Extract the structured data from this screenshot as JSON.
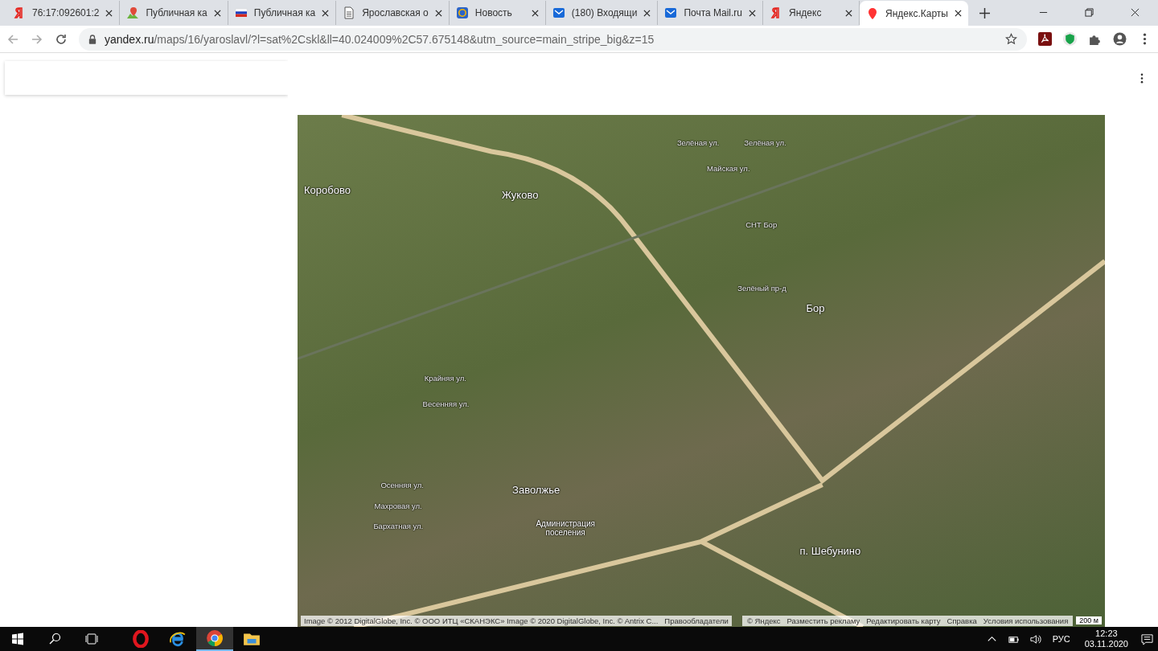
{
  "tabs": [
    {
      "title": "76:17:092601:2",
      "selected": false
    },
    {
      "title": "Публичная ка",
      "selected": false
    },
    {
      "title": "Публичная ка",
      "selected": false
    },
    {
      "title": "Ярославская о",
      "selected": false
    },
    {
      "title": "Новость",
      "selected": false
    },
    {
      "title": "(180) Входящи",
      "selected": false
    },
    {
      "title": "Почта Mail.ru",
      "selected": false
    },
    {
      "title": "Яндекс",
      "selected": false
    },
    {
      "title": "Яндекс.Карты",
      "selected": true
    }
  ],
  "address_bar": {
    "url_host": "yandex.ru",
    "url_path": "/maps/16/yaroslavl/?l=sat%2Cskl&ll=40.024009%2C57.675148&utm_source=main_stripe_big&z=15"
  },
  "map": {
    "labels": [
      {
        "text": "Коробово",
        "kind": "place"
      },
      {
        "text": "Жуково",
        "kind": "place"
      },
      {
        "text": "Бор",
        "kind": "place"
      },
      {
        "text": "Заволжье",
        "kind": "place"
      },
      {
        "text": "п. Шебунино",
        "kind": "place"
      },
      {
        "text": "Администрация поселения",
        "kind": "poi"
      },
      {
        "text": "Зелёная ул.",
        "kind": "street"
      },
      {
        "text": "Зелёная ул.",
        "kind": "street"
      },
      {
        "text": "Майская ул.",
        "kind": "street"
      },
      {
        "text": "СНТ Бор",
        "kind": "street"
      },
      {
        "text": "Зелёный пр-д",
        "kind": "street"
      },
      {
        "text": "Крайняя ул.",
        "kind": "street"
      },
      {
        "text": "Весенняя ул.",
        "kind": "street"
      },
      {
        "text": "Осенняя ул.",
        "kind": "street"
      },
      {
        "text": "Махровая ул.",
        "kind": "street"
      },
      {
        "text": "Бархатная ул.",
        "kind": "street"
      }
    ],
    "attribution": "Image © 2012 DigitalGlobe, Inc. © ООО ИТЦ «СКАНЭКС» Image © 2020 DigitalGlobe, Inc. © Antrix C...",
    "rights_link": "Правообладатели",
    "footer_links": [
      "© Яндекс",
      "Разместить рекламу",
      "Редактировать карту",
      "Справка",
      "Условия использования"
    ],
    "scale": "200 м"
  },
  "taskbar": {
    "apps": [
      {
        "selected": false
      },
      {
        "selected": false
      },
      {
        "selected": true
      },
      {
        "selected": false
      }
    ],
    "language": "РУС",
    "time": "12:23",
    "date": "03.11.2020"
  }
}
